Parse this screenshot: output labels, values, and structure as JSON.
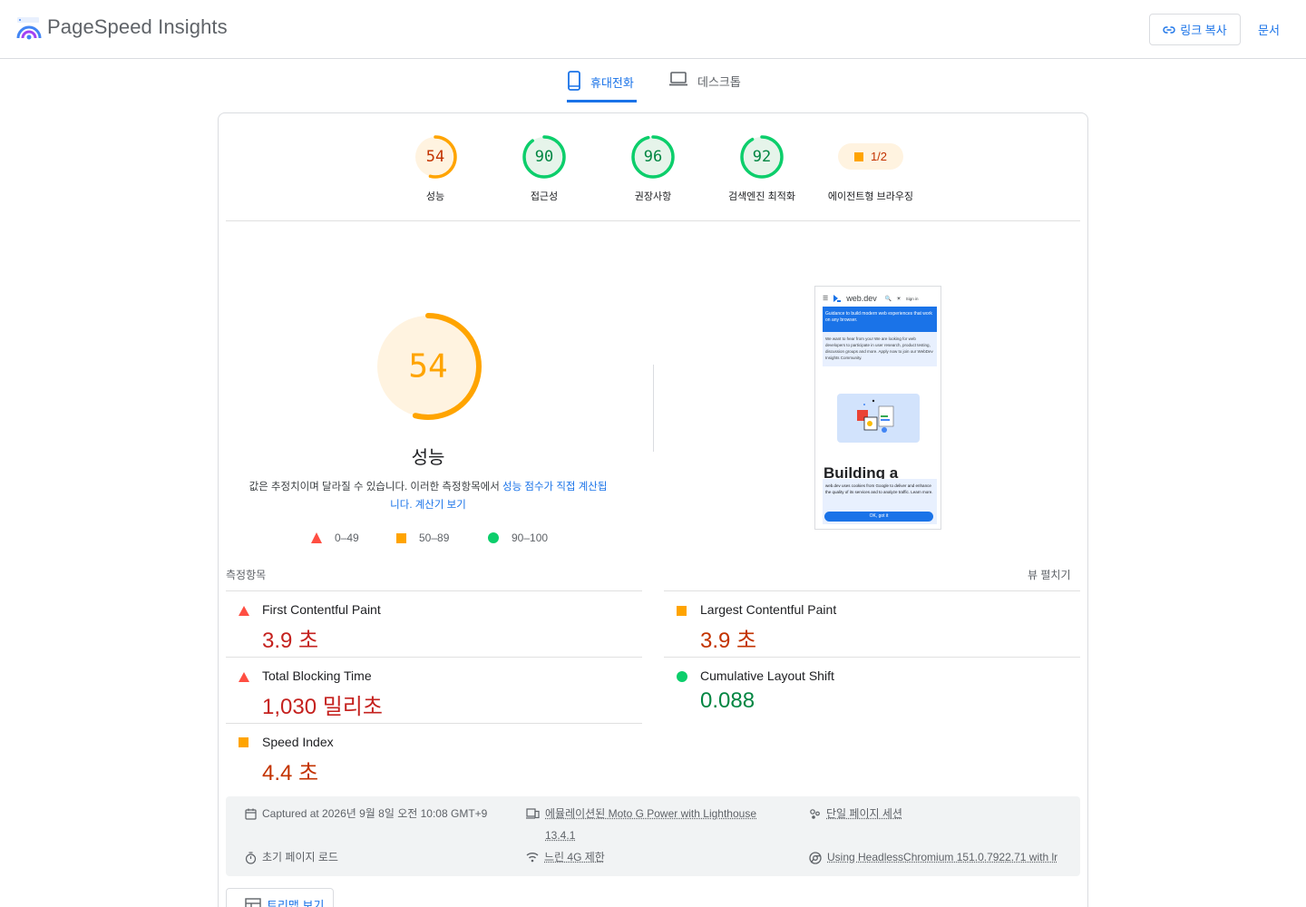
{
  "header": {
    "app_title": "PageSpeed Insights",
    "copy_link_label": "링크 복사",
    "docs_label": "문서"
  },
  "tabs": [
    {
      "label": "휴대전화",
      "icon": "mobile-phone-icon",
      "selected": true
    },
    {
      "label": "데스크톱",
      "icon": "laptop-icon",
      "selected": false
    }
  ],
  "categories": [
    {
      "label": "성능",
      "score": "54",
      "level": 54,
      "color": "#ffa400",
      "bg": "#fff3e0",
      "text_color": "#c33300"
    },
    {
      "label": "접근성",
      "score": "90",
      "level": 90,
      "color": "#0cce6b",
      "bg": "#e6f4ea",
      "text_color": "#018642"
    },
    {
      "label": "권장사항",
      "score": "96",
      "level": 96,
      "color": "#0cce6b",
      "bg": "#e6f4ea",
      "text_color": "#018642"
    },
    {
      "label": "검색엔진 최적화",
      "score": "92",
      "level": 92,
      "color": "#0cce6b",
      "bg": "#e6f4ea",
      "text_color": "#018642"
    }
  ],
  "pwa": {
    "label": "에이전트형 브라우징",
    "value": "1/2"
  },
  "performance": {
    "score": "54",
    "level": 54,
    "title": "성능",
    "desc_part1": "값은 추정치이며 달라질 수 있습니다. 이러한 측정항목에서 ",
    "desc_link1": "성능 점수가 직접 계산됩",
    "desc_link1b": "니다.",
    "desc_link2": "계산기 보기",
    "legend": [
      {
        "range": "0–49",
        "icon": "red-triangle"
      },
      {
        "range": "50–89",
        "icon": "orange-square"
      },
      {
        "range": "90–100",
        "icon": "green-circle"
      }
    ]
  },
  "screenshot": {
    "site_name": "web.dev",
    "sign_in": "Sign in",
    "banner": "Guidance to build modern web experiences that work on any browser.",
    "note": "We want to hear from you! We are looking for web developers to participate in user research, product testing, discussion groups and more. Apply now to join our WebDev Insights Community.",
    "heading": "Building a",
    "cookie": "web.dev uses cookies from Google to deliver and enhance the quality of its services and to analyze traffic. Learn more.",
    "ok": "OK, got it"
  },
  "metrics": {
    "header": "측정항목",
    "expand_label": "뷰 펼치기",
    "items": [
      {
        "name": "First Contentful Paint",
        "value": "3.9 초",
        "rating": "red"
      },
      {
        "name": "Largest Contentful Paint",
        "value": "3.9 초",
        "rating": "orange"
      },
      {
        "name": "Total Blocking Time",
        "value": "1,030 밀리초",
        "rating": "red"
      },
      {
        "name": "Cumulative Layout Shift",
        "value": "0.088",
        "rating": "green"
      },
      {
        "name": "Speed Index",
        "value": "4.4 초",
        "rating": "orange"
      }
    ]
  },
  "run_info": {
    "captured": "Captured at 2026년 9월 8일 오전 10:08 GMT+9",
    "device": "에뮬레이션된 Moto G Power with Lighthouse",
    "device_version": "13.4.1",
    "session": "단일 페이지 세션",
    "load": "초기 페이지 로드",
    "throttle": "느린 4G 제한",
    "browser": "Using HeadlessChromium 151.0.7922.71 with lr"
  },
  "treemap_label": "트리맵 보기"
}
